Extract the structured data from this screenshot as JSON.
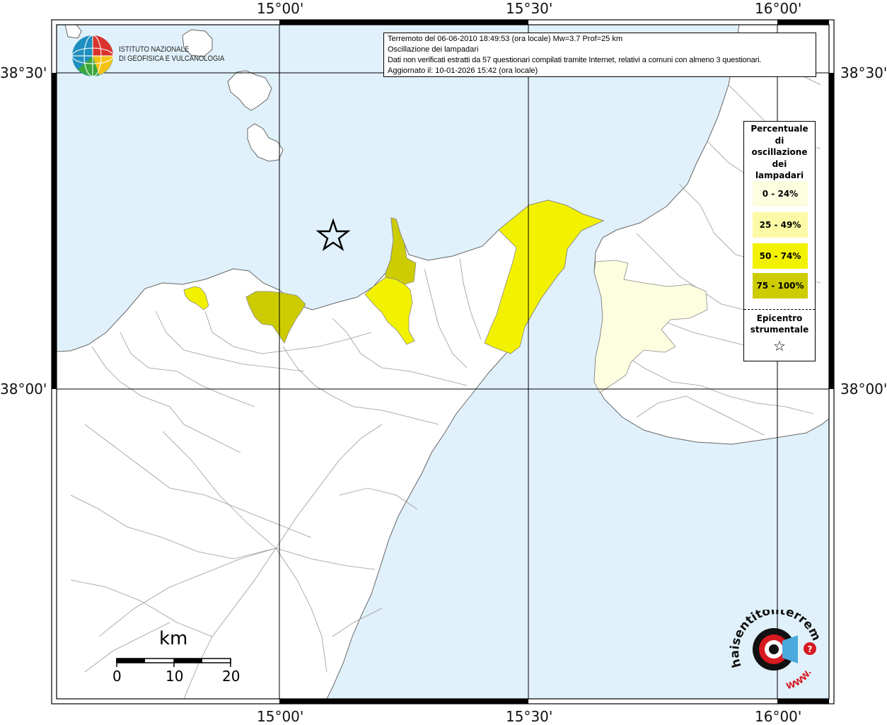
{
  "axes": {
    "lon_top": [
      "15°00'",
      "15°30'",
      "16°00'"
    ],
    "lon_bottom": [
      "15°00'",
      "15°30'",
      "16°00'"
    ],
    "lat_left": [
      "38°30'",
      "38°00'"
    ],
    "lat_right": [
      "38°30'",
      "38°00'"
    ]
  },
  "info": {
    "line1": "Terremoto del 06-06-2010 18:49:53 (ora locale) Mw=3.7 Prof=25 km",
    "line2": "Oscillazione dei lampadari",
    "line3": "Dati non verificati estratti da 57 questionari compilati tramite Internet, relativi a comuni con almeno 3 questionari.",
    "line4": "Aggiornato il: 10-01-2026 15:42 (ora locale)"
  },
  "institute": {
    "line1": "ISTITUTO NAZIONALE",
    "line2": "DI GEOFISICA E VULCANOLOGIA"
  },
  "legend": {
    "title": [
      "Percentuale",
      "di",
      "oscillazione",
      "dei",
      "lampadari"
    ],
    "classes": [
      {
        "label": "0 - 24%",
        "color": "#fdfde0"
      },
      {
        "label": "25 - 49%",
        "color": "#fcfaa6"
      },
      {
        "label": "50 - 74%",
        "color": "#f2f200"
      },
      {
        "label": "75 - 100%",
        "color": "#cccc00"
      }
    ],
    "epicenter_title": [
      "Epicentro",
      "strumentale"
    ],
    "epicenter_symbol": "☆"
  },
  "scale": {
    "unit": "km",
    "labels": [
      "0",
      "10",
      "20"
    ]
  },
  "logo_hst": {
    "text": "haisentitoilterremoto.it",
    "www": "WWW.",
    "question": "?"
  },
  "colors": {
    "sea": "#e1f1fb",
    "land": "#ffffff",
    "borders": "#999999",
    "grid": "#000000"
  }
}
